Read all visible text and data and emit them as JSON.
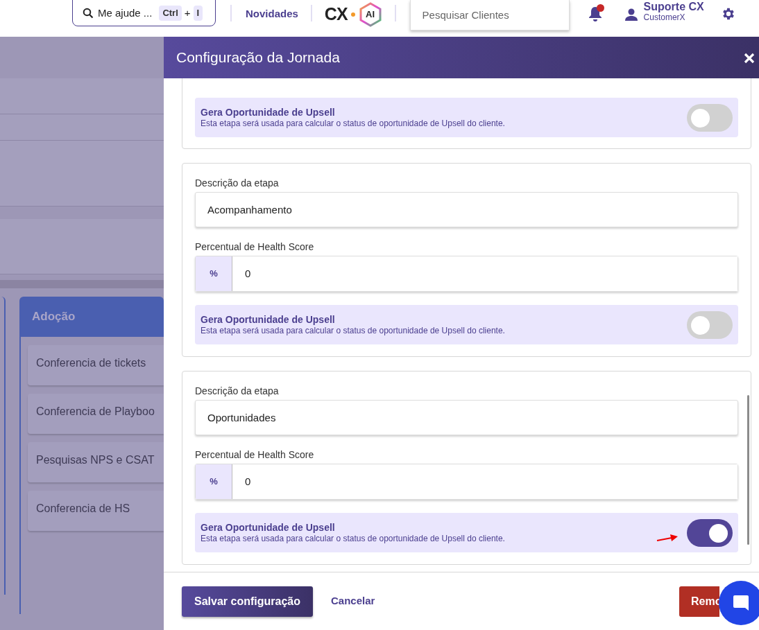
{
  "header": {
    "help_search": {
      "label": "Me ajude ...",
      "shortcut": [
        "Ctrl",
        "+",
        "I"
      ]
    },
    "news_link": "Novidades",
    "logo": {
      "text": "CX",
      "badge": "AI"
    },
    "client_search": {
      "placeholder": "Pesquisar Clientes"
    },
    "notifications": {
      "unread": true
    },
    "user": {
      "name": "Suporte CX",
      "company": "CustomerX"
    }
  },
  "background": {
    "column": {
      "title": "Adoção",
      "cards": [
        "Conferencia de tickets",
        "Conferencia de Playboo",
        "Pesquisas NPS e CSAT",
        "Conferencia de HS"
      ]
    }
  },
  "panel": {
    "title": "Configuração da Jornada",
    "stages": [
      {
        "upsell": {
          "label": "Gera Oportunidade de Upsell",
          "hint": "Esta etapa será usada para calcular o status de oportunidade de Upsell do cliente.",
          "on": false
        }
      },
      {
        "description_label": "Descrição da etapa",
        "description": "Acompanhamento",
        "health_label": "Percentual de Health Score",
        "health_prefix": "%",
        "health_value": "0",
        "upsell": {
          "label": "Gera Oportunidade de Upsell",
          "hint": "Esta etapa será usada para calcular o status de oportunidade de Upsell do cliente.",
          "on": false
        }
      },
      {
        "description_label": "Descrição da etapa",
        "description": "Oportunidades",
        "health_label": "Percentual de Health Score",
        "health_prefix": "%",
        "health_value": "0",
        "upsell": {
          "label": "Gera Oportunidade de Upsell",
          "hint": "Esta etapa será usada para calcular o status de oportunidade de Upsell do cliente.",
          "on": true
        },
        "annotated": true
      }
    ],
    "save_button": "Salvar configuração",
    "cancel_link": "Cancelar",
    "remove_button": "Remo"
  }
}
